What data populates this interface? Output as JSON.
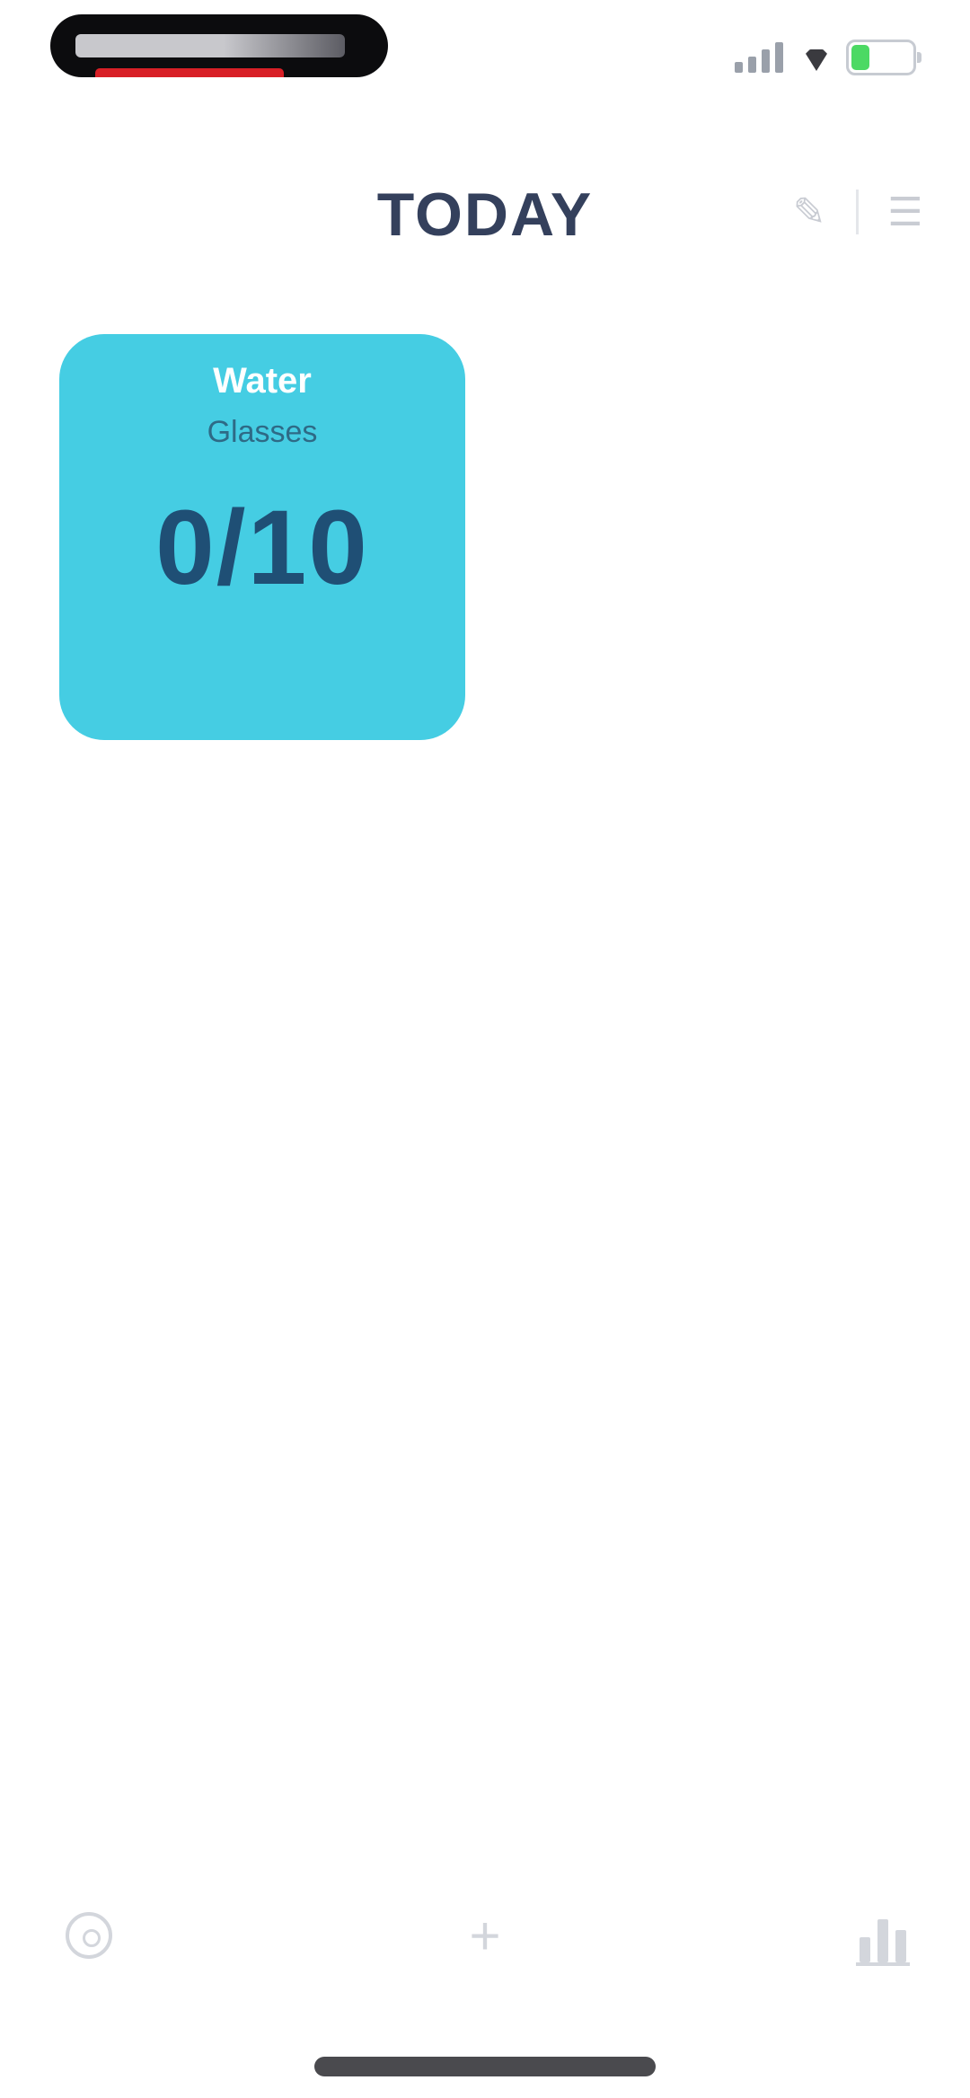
{
  "header": {
    "title": "TODAY"
  },
  "habit_card": {
    "name": "Water",
    "subtitle": "Glasses",
    "progress_text": "0/10",
    "progress_value": 0,
    "progress_goal": 10,
    "color": "#45cde3"
  },
  "status_bar": {
    "battery_level": 0.28,
    "icons": [
      "signal-icon",
      "wifi-icon",
      "battery-icon"
    ]
  },
  "header_actions": {
    "icons": [
      "edit-icon",
      "menu-icon"
    ]
  },
  "bottom_bar": {
    "icons": [
      "settings-icon",
      "add-icon",
      "stats-icon"
    ]
  },
  "colors": {
    "accent": "#45cde3",
    "title": "#34405c",
    "count": "#1f4f75"
  }
}
